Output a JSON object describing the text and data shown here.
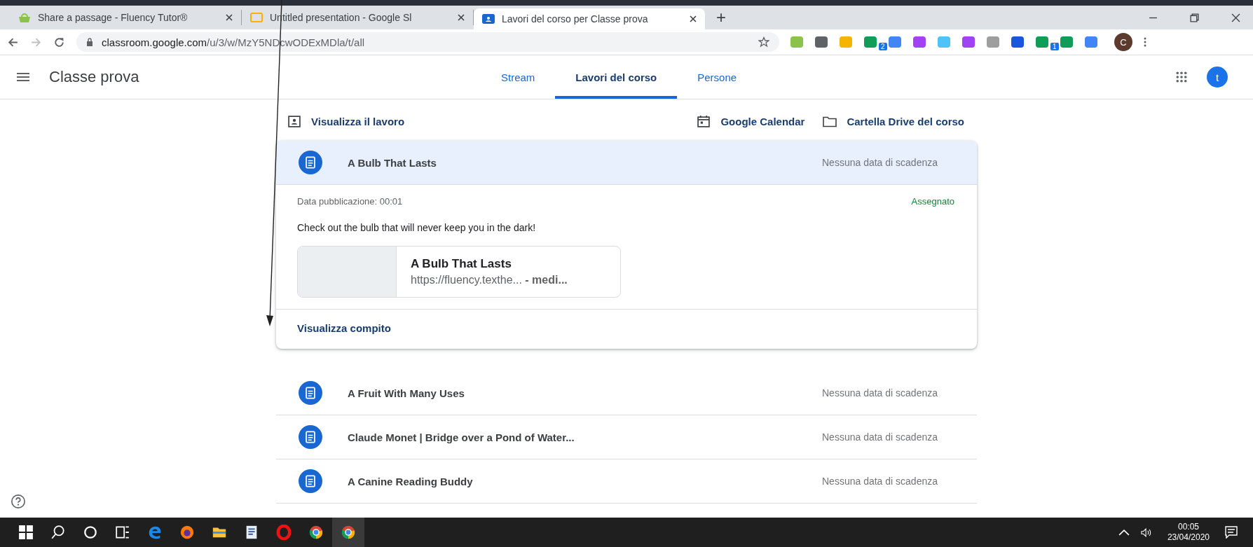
{
  "browser": {
    "tabs": [
      {
        "title": "Share a passage - Fluency Tutor®",
        "kind": "fluency",
        "selected": false
      },
      {
        "title": "Untitled presentation - Google Sl",
        "kind": "slides",
        "selected": false
      },
      {
        "title": "Lavori del corso per Classe prova",
        "kind": "classroom",
        "selected": true
      }
    ],
    "new_tab": "+",
    "address": {
      "host": "classroom.google.com",
      "path": "/u/3/w/MzY5NDcwODExMDla/t/all"
    },
    "extensions": [
      {
        "color": "#8bc34a"
      },
      {
        "color": "#5f6368"
      },
      {
        "color": "#f4b400"
      },
      {
        "color": "#0f9d58",
        "badge": "2"
      },
      {
        "color": "#4285f4"
      },
      {
        "color": "#a142f4"
      },
      {
        "color": "#4fc3f7"
      },
      {
        "color": "#a142f4"
      },
      {
        "color": "#9e9e9e"
      },
      {
        "color": "#1a56db"
      },
      {
        "color": "#0f9d58",
        "badge": "1"
      },
      {
        "color": "#0f9d58"
      },
      {
        "color": "#4285f4"
      }
    ],
    "profile": "C"
  },
  "app": {
    "title": "Classe prova",
    "nav": [
      {
        "label": "Stream",
        "selected": false
      },
      {
        "label": "Lavori del corso",
        "selected": true
      },
      {
        "label": "Persone",
        "selected": false
      }
    ],
    "avatar": "t"
  },
  "actions": {
    "view_work": "Visualizza il lavoro",
    "calendar": "Google Calendar",
    "drive": "Cartella Drive del corso"
  },
  "assignments": [
    {
      "title": "A Bulb That Lasts",
      "due": "Nessuna data di scadenza",
      "expanded": true,
      "posted": "Data pubblicazione: 00:01",
      "status": "Assegnato",
      "description": "Check out the bulb that will never keep you in the dark!",
      "attachment": {
        "title": "A Bulb That Lasts",
        "url": "https://fluency.texthe... **- medi...**"
      },
      "link": "Visualizza compito"
    },
    {
      "title": "A Fruit With Many Uses",
      "due": "Nessuna data di scadenza",
      "expanded": false
    },
    {
      "title": "Claude Monet | Bridge over a Pond of Water...",
      "due": "Nessuna data di scadenza",
      "expanded": false
    },
    {
      "title": "A Canine Reading Buddy",
      "due": "Nessuna data di scadenza",
      "expanded": false
    }
  ],
  "taskbar": {
    "time": "00:05",
    "date": "23/04/2020"
  }
}
